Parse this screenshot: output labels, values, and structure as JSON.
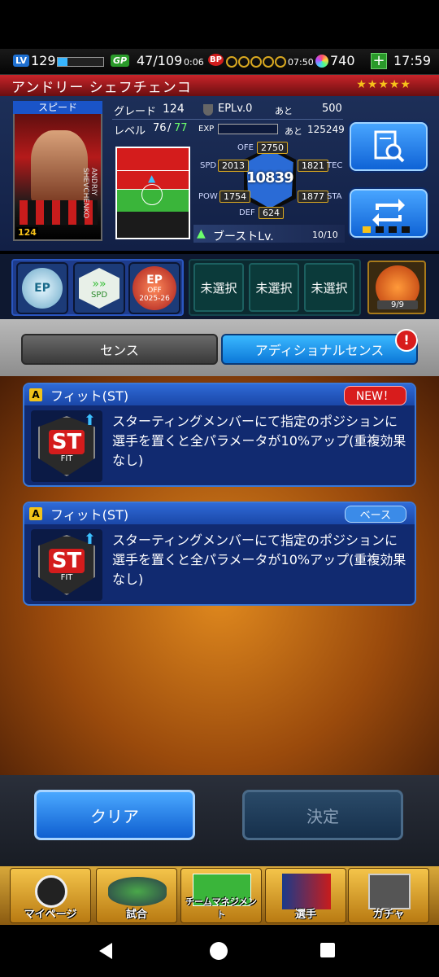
{
  "hud": {
    "level": "129",
    "lv_tag": "LV",
    "gp_tag": "GP",
    "gp": "47/109",
    "gp_timer": "0:06",
    "bp_tag": "BP",
    "bp_timer": "07:50",
    "gems": "740",
    "clock": "17:59"
  },
  "player": {
    "name": "アンドリー シェフチェンコ",
    "stars": "★★★★★",
    "card_label": "スピード",
    "card_grade": "124",
    "card_name": "ANDRIY SHEVCHENKO",
    "grade_label": "グレード",
    "grade": "124",
    "ep_label": "EPLv.0",
    "ato": "あと",
    "ep_remaining": "500",
    "level_label": "レベル",
    "level": "76",
    "level_max": "77",
    "exp_label": "EXP",
    "exp_remaining": "125249",
    "boost_label": "ブーストLv.",
    "boost": "10/10"
  },
  "stats": {
    "ofe_label": "OFE",
    "ofe": "2750",
    "spd_label": "SPD",
    "spd": "2013",
    "tec_label": "TEC",
    "tec": "1821",
    "pow_label": "POW",
    "pow": "1754",
    "sta_label": "STA",
    "sta": "1877",
    "def_label": "DEF",
    "def": "624",
    "total": "10839"
  },
  "skills_row": {
    "slots": [
      "未選択",
      "未選択",
      "未選択"
    ],
    "badge_ep": "EP",
    "badge_spd": "SPD",
    "badge_ofe_ep": "EP",
    "badge_ofe_text": "OFF",
    "badge_ofe_year": "2025-26",
    "coach_count": "9/9"
  },
  "tabs": {
    "sense": "センス",
    "additional": "アディショナルセンス",
    "alert": "!"
  },
  "cards": [
    {
      "grade": "A",
      "title": "フィット(ST)",
      "tag": "NEW！",
      "icon_text": "ST",
      "icon_sub": "FIT",
      "desc": "スターティングメンバーにて指定のポジションに選手を置くと全パラメータが10%アップ(重複効果なし)"
    },
    {
      "grade": "A",
      "title": "フィット(ST)",
      "tag": "ベース",
      "icon_text": "ST",
      "icon_sub": "FIT",
      "desc": "スターティングメンバーにて指定のポジションに選手を置くと全パラメータが10%アップ(重複効果なし)"
    }
  ],
  "actions": {
    "clear": "クリア",
    "confirm": "決定"
  },
  "nav": {
    "mypage": "マイページ",
    "match": "試合",
    "team": "チームマネジメント",
    "players": "選手",
    "gacha": "ガチャ"
  },
  "colors": {
    "accent": "#1f7bf0",
    "name_bar": "#c8242a",
    "stars": "#f7c21a",
    "new_tag": "#d81c1c",
    "base_tag": "#3b8be8"
  }
}
